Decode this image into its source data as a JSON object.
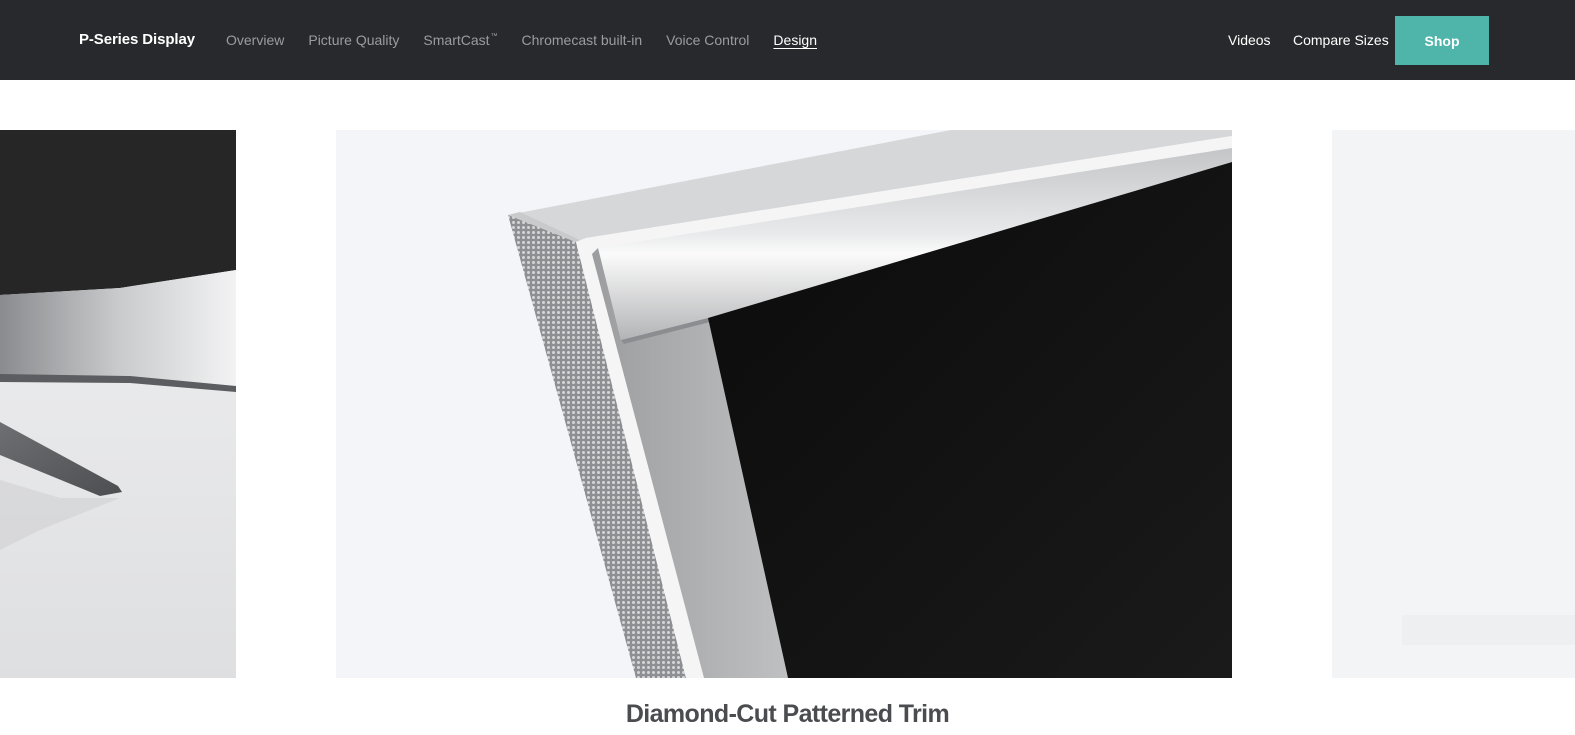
{
  "nav": {
    "brand": "P-Series Display",
    "links": [
      {
        "label": "Overview"
      },
      {
        "label": "Picture Quality"
      },
      {
        "label": "SmartCast",
        "sup": "™"
      },
      {
        "label": "Chromecast built-in"
      },
      {
        "label": "Voice Control"
      },
      {
        "label": "Design",
        "active": true
      }
    ],
    "right_links": [
      {
        "label": "Videos"
      },
      {
        "label": "Compare Sizes"
      }
    ],
    "shop_label": "Shop"
  },
  "carousel": {
    "active_slide_caption": "Diamond-Cut Patterned Trim"
  },
  "colors": {
    "nav_bg": "#28292c",
    "accent": "#4fb5ab",
    "caption_text": "#4b4c50"
  }
}
